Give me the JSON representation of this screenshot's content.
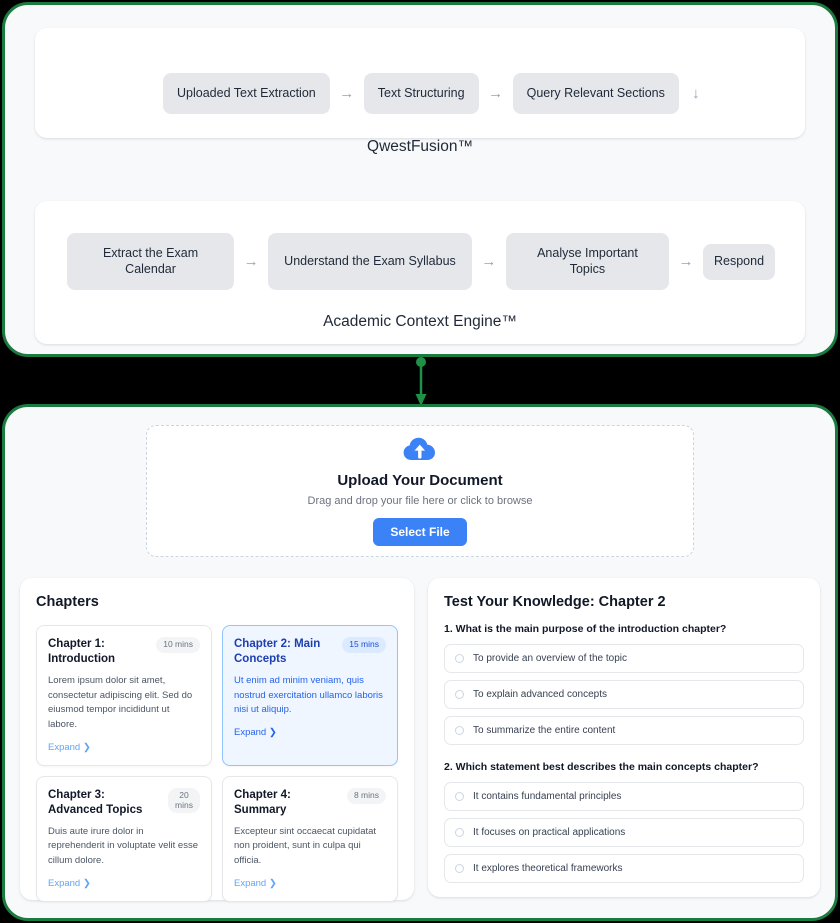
{
  "colors": {
    "panel_border_green": "#1a7a3f",
    "panel_bg": "#f7f9fb",
    "accent_blue": "#3b82f6",
    "pipe_box_bg": "#e5e7eb",
    "active_chapter_bg": "#eff6ff",
    "active_chapter_border": "#93c5fd",
    "connector_green": "#1f9147"
  },
  "pipelines": [
    {
      "name": "qwestfusion",
      "engine_label": "QwestFusion™",
      "steps": [
        {
          "label": "Uploaded Text Extraction"
        },
        {
          "label": "Text Structuring"
        },
        {
          "label": "Query Relevant Sections"
        }
      ],
      "arrow_glyph": "→",
      "trailing_arrow_glyph": "↓"
    },
    {
      "name": "academic-context-engine",
      "engine_label": "Academic Context Engine™",
      "steps": [
        {
          "label": "Extract the Exam Calendar"
        },
        {
          "label": "Understand the Exam Syllabus"
        },
        {
          "label": "Analyse Important Topics"
        },
        {
          "label": "Respond"
        }
      ],
      "arrow_glyph": "→"
    }
  ],
  "connector": {
    "icon": "down-arrow-connector"
  },
  "upload": {
    "icon": "cloud-upload-icon",
    "title": "Upload Your Document",
    "subtitle": "Drag and drop your file here or click to browse",
    "button_label": "Select File"
  },
  "chapters_panel": {
    "title": "Chapters",
    "expand_label": "Expand",
    "expand_chevron": "❯",
    "items": [
      {
        "title": "Chapter 1: Introduction",
        "duration": "10 mins",
        "description": "Lorem ipsum dolor sit amet, consectetur adipiscing elit. Sed do eiusmod tempor incididunt ut labore.",
        "active": false
      },
      {
        "title": "Chapter 2: Main Concepts",
        "duration": "15 mins",
        "description": "Ut enim ad minim veniam, quis nostrud exercitation ullamco laboris nisi ut aliquip.",
        "active": true
      },
      {
        "title": "Chapter 3: Advanced Topics",
        "duration": "20\nmins",
        "description": "Duis aute irure dolor in reprehenderit in voluptate velit esse cillum dolore.",
        "active": false
      },
      {
        "title": "Chapter 4: Summary",
        "duration": "8 mins",
        "description": "Excepteur sint occaecat cupidatat non proident, sunt in culpa qui officia.",
        "active": false
      }
    ]
  },
  "quiz_panel": {
    "title": "Test Your Knowledge: Chapter 2",
    "questions": [
      {
        "prompt": "1. What is the main purpose of the introduction chapter?",
        "options": [
          "To provide an overview of the topic",
          "To explain advanced concepts",
          "To summarize the entire content"
        ]
      },
      {
        "prompt": "2. Which statement best describes the main concepts chapter?",
        "options": [
          "It contains fundamental principles",
          "It focuses on practical applications",
          "It explores theoretical frameworks"
        ]
      }
    ]
  }
}
